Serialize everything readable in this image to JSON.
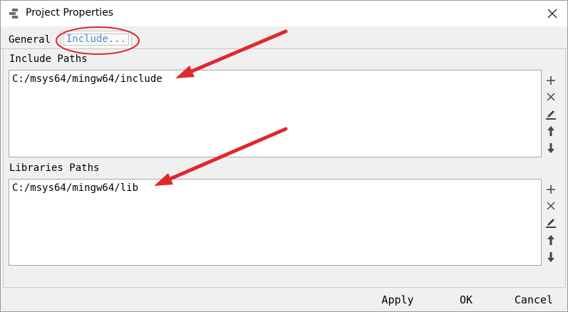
{
  "window": {
    "title": "Project Properties",
    "icon": "project-icon",
    "close_icon": "close-icon"
  },
  "tabs": [
    {
      "label": "General",
      "active": false
    },
    {
      "label": "Include...",
      "active": true
    }
  ],
  "include_paths": {
    "label": "Include Paths",
    "items": [
      "C:/msys64/mingw64/include"
    ]
  },
  "library_paths": {
    "label": "Libraries Paths",
    "items": [
      "C:/msys64/mingw64/lib"
    ]
  },
  "side_buttons": [
    "add-icon",
    "remove-icon",
    "edit-icon",
    "move-up-icon",
    "move-down-icon"
  ],
  "footer": {
    "apply": "Apply",
    "ok": "OK",
    "cancel": "Cancel"
  },
  "colors": {
    "active_tab_text": "#4a8fd6",
    "annotation_red": "#e0282d"
  }
}
